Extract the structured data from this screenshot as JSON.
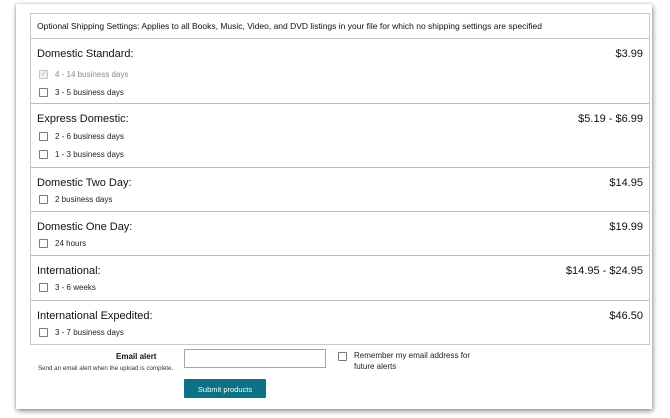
{
  "header": {
    "text": "Optional Shipping Settings: Applies to all Books, Music, Video, and DVD listings in your file for which no shipping settings are specified"
  },
  "sections": [
    {
      "title": "Domestic Standard:",
      "price": "$3.99",
      "options": [
        {
          "label": "4 - 14 business days",
          "checked": true,
          "disabled": true
        },
        {
          "label": "3 - 5 business days",
          "checked": false,
          "disabled": false
        }
      ]
    },
    {
      "title": "Express Domestic:",
      "price": "$5.19 - $6.99",
      "options": [
        {
          "label": "2 - 6 business days",
          "checked": false,
          "disabled": false
        },
        {
          "label": "1 - 3 business days",
          "checked": false,
          "disabled": false
        }
      ]
    },
    {
      "title": "Domestic Two Day:",
      "price": "$14.95",
      "options": [
        {
          "label": "2 business days",
          "checked": false,
          "disabled": false
        }
      ]
    },
    {
      "title": "Domestic One Day:",
      "price": "$19.99",
      "options": [
        {
          "label": "24 hours",
          "checked": false,
          "disabled": false
        }
      ]
    },
    {
      "title": "International:",
      "price": "$14.95 - $24.95",
      "options": [
        {
          "label": "3 - 6 weeks",
          "checked": false,
          "disabled": false
        }
      ]
    },
    {
      "title": "International Expedited:",
      "price": "$46.50",
      "options": [
        {
          "label": "3 - 7 business days",
          "checked": false,
          "disabled": false
        }
      ]
    }
  ],
  "email_alert": {
    "label": "Email alert",
    "description": "Send an email alert when the upload is complete.",
    "value": "",
    "remember_label": "Remember my email address for future alerts",
    "remember_checked": false
  },
  "submit_label": "Submit products",
  "colors": {
    "submit_bg": "#0b7285",
    "border": "#c8c8c8"
  }
}
